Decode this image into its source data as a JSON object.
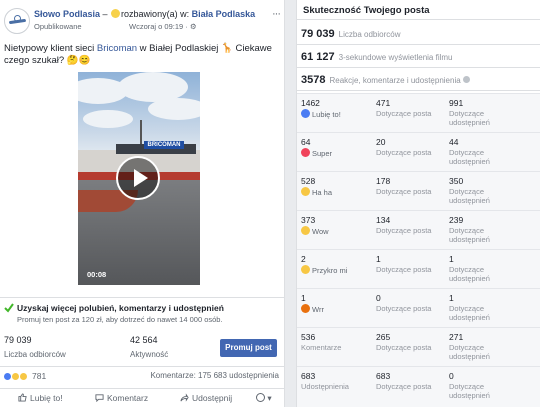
{
  "post": {
    "page_name": "Słowo Podlasia",
    "status_text": "– ",
    "feeling": "rozbawiony(a) w: ",
    "location": "Biała Podlaska",
    "published": "Opublikowane",
    "time": "Wczoraj o 09:19 · ",
    "text_before": "Nietypowy klient sieci ",
    "text_link": "Bricoman",
    "text_after": " w Białej Podlaskiej 🦒 Ciekawe czego szukał? 🤔😊",
    "video_sign": "BRICOMAN",
    "video_time": "00:08",
    "promo_title": "Uzyskaj więcej polubień, komentarzy i udostępnień",
    "promo_desc": "Promuj ten post za 120 zł, aby dotrzeć do nawet 14 000 osób.",
    "reach_value": "79 039",
    "reach_label": "Liczba odbiorców",
    "engagement_value": "42 564",
    "engagement_label": "Aktywność",
    "boost_label": "Promuj post",
    "reactions_count": "781",
    "comments_shares": "Komentarze: 175  683 udostępnienia",
    "actions": {
      "like": "Lubię to!",
      "comment": "Komentarz",
      "share": "Udostępnij"
    }
  },
  "insights": {
    "title": "Skuteczność Twojego posta",
    "reach_value": "79 039",
    "reach_caption": "Liczba odbiorców",
    "views_value": "61 127",
    "views_caption": "3-sekundowe wyświetlenia filmu",
    "interactions_value": "3578",
    "interactions_caption": "Reakcje, komentarze i udostępnienia",
    "rows": [
      {
        "total": "1462",
        "label": "Lubię to!",
        "icon": "like-icon",
        "color": "#4a7cf3",
        "on_post": "471",
        "on_post_label": "Dotyczące posta",
        "on_shares": "991",
        "on_shares_label": "Dotyczące udostępnień"
      },
      {
        "total": "64",
        "label": "Super",
        "icon": "love-icon",
        "color": "#f0435b",
        "on_post": "20",
        "on_post_label": "Dotyczące posta",
        "on_shares": "44",
        "on_shares_label": "Dotyczące udostępnień"
      },
      {
        "total": "528",
        "label": "Ha ha",
        "icon": "haha-icon",
        "color": "#f7c744",
        "on_post": "178",
        "on_post_label": "Dotyczące posta",
        "on_shares": "350",
        "on_shares_label": "Dotyczące udostępnień"
      },
      {
        "total": "373",
        "label": "Wow",
        "icon": "wow-icon",
        "color": "#f7c744",
        "on_post": "134",
        "on_post_label": "Dotyczące posta",
        "on_shares": "239",
        "on_shares_label": "Dotyczące udostępnień"
      },
      {
        "total": "2",
        "label": "Przykro mi",
        "icon": "sad-icon",
        "color": "#f7c744",
        "on_post": "1",
        "on_post_label": "Dotyczące posta",
        "on_shares": "1",
        "on_shares_label": "Dotyczące udostępnień"
      },
      {
        "total": "1",
        "label": "Wrr",
        "icon": "angry-icon",
        "color": "#e9710f",
        "on_post": "0",
        "on_post_label": "Dotyczące posta",
        "on_shares": "1",
        "on_shares_label": "Dotyczące udostępnień"
      },
      {
        "total": "536",
        "label": "Komentarze",
        "icon": "",
        "color": "",
        "on_post": "265",
        "on_post_label": "Dotyczące posta",
        "on_shares": "271",
        "on_shares_label": "Dotyczące udostępnień"
      },
      {
        "total": "683",
        "label": "Udostępnienia",
        "icon": "",
        "color": "",
        "on_post": "683",
        "on_post_label": "Dotyczące posta",
        "on_shares": "0",
        "on_shares_label": "Dotyczące udostępnień"
      }
    ]
  }
}
